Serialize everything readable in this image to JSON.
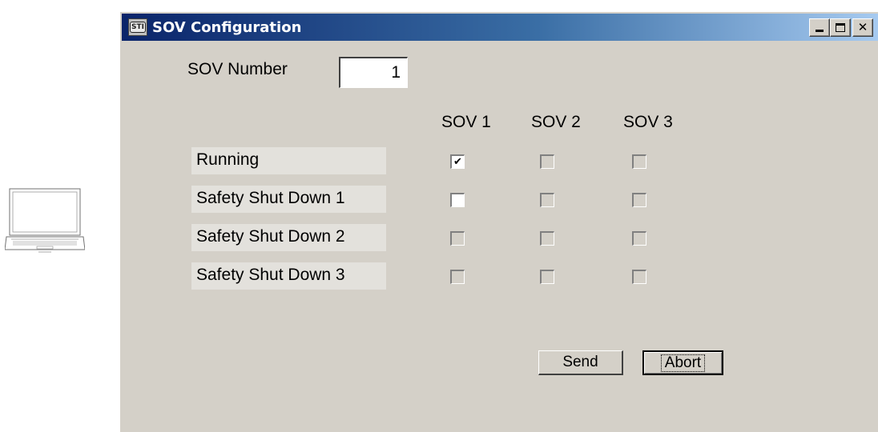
{
  "window": {
    "title": "SOV Configuration",
    "icon_text": "STI",
    "controls": [
      "minimize-icon",
      "maximize-icon",
      "close-icon"
    ]
  },
  "sov_number": {
    "label": "SOV Number",
    "value": "1"
  },
  "columns": [
    "SOV 1",
    "SOV 2",
    "SOV 3"
  ],
  "rows": [
    {
      "label": "Running",
      "checks": [
        {
          "checked": true,
          "enabled": true
        },
        {
          "checked": false,
          "enabled": false
        },
        {
          "checked": false,
          "enabled": false
        }
      ]
    },
    {
      "label": "Safety Shut Down 1",
      "checks": [
        {
          "checked": false,
          "enabled": true
        },
        {
          "checked": false,
          "enabled": false
        },
        {
          "checked": false,
          "enabled": false
        }
      ]
    },
    {
      "label": "Safety Shut Down 2",
      "checks": [
        {
          "checked": false,
          "enabled": false
        },
        {
          "checked": false,
          "enabled": false
        },
        {
          "checked": false,
          "enabled": false
        }
      ]
    },
    {
      "label": "Safety Shut Down 3",
      "checks": [
        {
          "checked": false,
          "enabled": false
        },
        {
          "checked": false,
          "enabled": false
        },
        {
          "checked": false,
          "enabled": false
        }
      ]
    }
  ],
  "buttons": {
    "send": "Send",
    "abort": "Abort"
  },
  "colors": {
    "titlebar_start": "#0a246a",
    "titlebar_end": "#a6caf0",
    "window_bg": "#d4d0c8"
  }
}
